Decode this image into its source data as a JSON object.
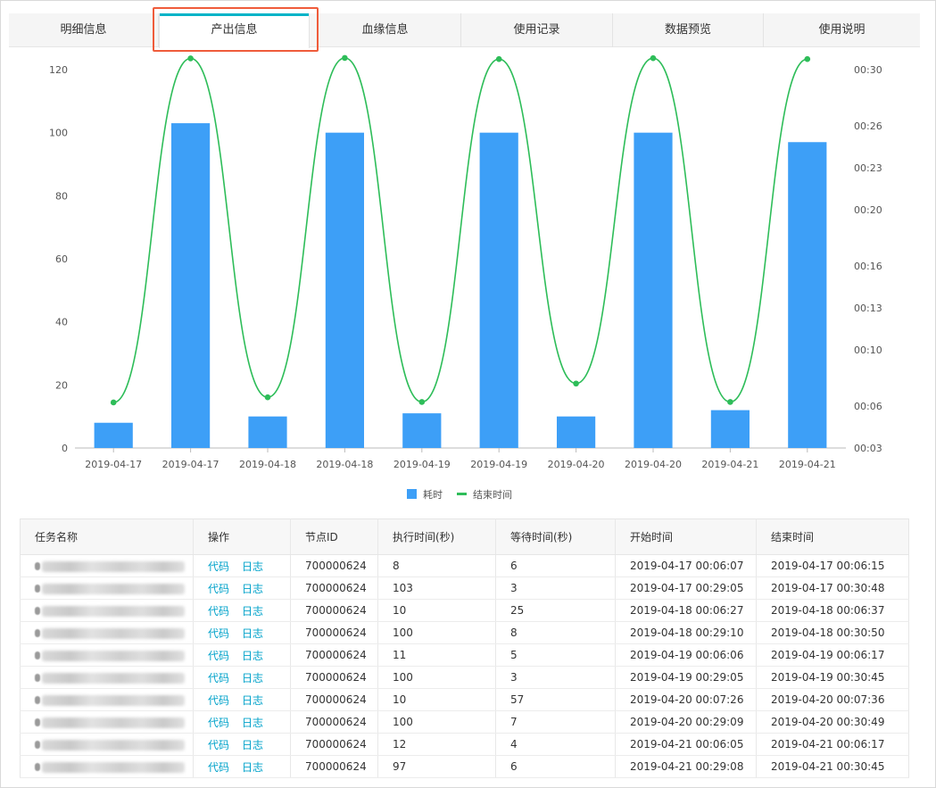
{
  "tabs": [
    {
      "label": "明细信息"
    },
    {
      "label": "产出信息",
      "active": true
    },
    {
      "label": "血缘信息"
    },
    {
      "label": "使用记录"
    },
    {
      "label": "数据预览"
    },
    {
      "label": "使用说明"
    }
  ],
  "chart_data": {
    "type": "bar+line",
    "categories": [
      "2019-04-17",
      "2019-04-17",
      "2019-04-18",
      "2019-04-18",
      "2019-04-19",
      "2019-04-19",
      "2019-04-20",
      "2019-04-20",
      "2019-04-21",
      "2019-04-21"
    ],
    "series": [
      {
        "name": "耗时",
        "type": "bar",
        "axis": "left",
        "color": "#3d9ff7",
        "values": [
          8,
          103,
          10,
          100,
          11,
          100,
          10,
          100,
          12,
          97
        ]
      },
      {
        "name": "结束时间",
        "type": "line",
        "axis": "right",
        "color": "#2ebd59",
        "values": [
          "00:06:15",
          "00:30:48",
          "00:06:37",
          "00:30:50",
          "00:06:17",
          "00:30:45",
          "00:07:36",
          "00:30:49",
          "00:06:17",
          "00:30:45"
        ]
      }
    ],
    "left_axis": {
      "ylim": [
        0,
        120
      ],
      "ticks": [
        "0",
        "20",
        "40",
        "60",
        "80",
        "100",
        "120"
      ]
    },
    "right_axis": {
      "ticks": [
        "00:03",
        "00:06",
        "00:10",
        "00:13",
        "00:16",
        "00:20",
        "00:23",
        "00:26",
        "00:30"
      ]
    },
    "legend_position": "bottom-center",
    "grid": false
  },
  "table": {
    "columns": [
      "任务名称",
      "操作",
      "节点ID",
      "执行时间(秒)",
      "等待时间(秒)",
      "开始时间",
      "结束时间"
    ],
    "action_labels": {
      "code": "代码",
      "log": "日志"
    },
    "rows": [
      {
        "node_id": "700000624",
        "exec": "8",
        "wait": "6",
        "start": "2019-04-17 00:06:07",
        "end": "2019-04-17 00:06:15"
      },
      {
        "node_id": "700000624",
        "exec": "103",
        "wait": "3",
        "start": "2019-04-17 00:29:05",
        "end": "2019-04-17 00:30:48"
      },
      {
        "node_id": "700000624",
        "exec": "10",
        "wait": "25",
        "start": "2019-04-18 00:06:27",
        "end": "2019-04-18 00:06:37"
      },
      {
        "node_id": "700000624",
        "exec": "100",
        "wait": "8",
        "start": "2019-04-18 00:29:10",
        "end": "2019-04-18 00:30:50"
      },
      {
        "node_id": "700000624",
        "exec": "11",
        "wait": "5",
        "start": "2019-04-19 00:06:06",
        "end": "2019-04-19 00:06:17"
      },
      {
        "node_id": "700000624",
        "exec": "100",
        "wait": "3",
        "start": "2019-04-19 00:29:05",
        "end": "2019-04-19 00:30:45"
      },
      {
        "node_id": "700000624",
        "exec": "10",
        "wait": "57",
        "start": "2019-04-20 00:07:26",
        "end": "2019-04-20 00:07:36"
      },
      {
        "node_id": "700000624",
        "exec": "100",
        "wait": "7",
        "start": "2019-04-20 00:29:09",
        "end": "2019-04-20 00:30:49"
      },
      {
        "node_id": "700000624",
        "exec": "12",
        "wait": "4",
        "start": "2019-04-21 00:06:05",
        "end": "2019-04-21 00:06:17"
      },
      {
        "node_id": "700000624",
        "exec": "97",
        "wait": "6",
        "start": "2019-04-21 00:29:08",
        "end": "2019-04-21 00:30:45"
      }
    ]
  }
}
